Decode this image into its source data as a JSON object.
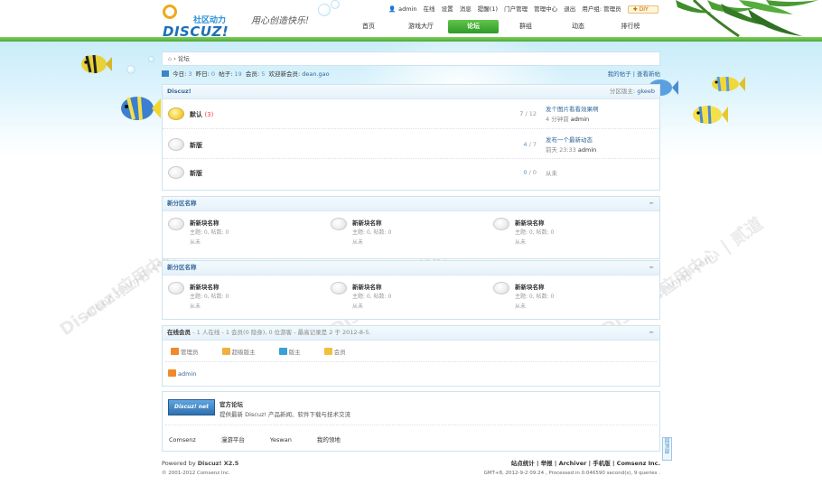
{
  "header": {
    "logo_cn": "社区动力",
    "logo_en": "DISCUZ!",
    "slogan": "用心创造快乐!",
    "user": {
      "name": "admin",
      "links": [
        "在线",
        "设置",
        "消息",
        "提醒(1)",
        "门户管理",
        "管理中心",
        "退出",
        "用户组: 管理员"
      ],
      "diy": "DIY"
    },
    "nav": [
      "首页",
      "游戏大厅",
      "论坛",
      "群组",
      "动态",
      "排行榜"
    ],
    "nav_active": 2
  },
  "breadcrumb": {
    "current": "论坛"
  },
  "stats": {
    "today_label": "今日:",
    "today": "3",
    "yesterday_label": "昨日:",
    "yesterday": "0",
    "posts_label": "帖子:",
    "posts": "19",
    "members_label": "会员:",
    "members": "5",
    "newmember_label": "欢迎新会员:",
    "newmember": "dean.gao",
    "link_mine": "我的帖子",
    "link_new": "查看新帖"
  },
  "sections": {
    "discuz": {
      "title": "Discuz!",
      "moderator_label": "分区版主:",
      "moderator": "gkeeb",
      "forums": [
        {
          "name": "默认",
          "today": "(3)",
          "threads": "7",
          "posts": "12",
          "last_title": "发个图片看看效果啊",
          "last_time": "4 分钟前",
          "last_user": "admin",
          "icon": "new"
        },
        {
          "name": "新版",
          "today": "",
          "threads": "4",
          "posts": "7",
          "last_title": "发布一个最新动态",
          "last_time": "前天 23:33",
          "last_user": "admin",
          "icon": "old"
        },
        {
          "name": "新版",
          "today": "",
          "threads": "0",
          "posts": "0",
          "last_title": "",
          "last_time": "从未",
          "last_user": "",
          "icon": "old"
        }
      ]
    },
    "new1": {
      "title": "新分区名称",
      "forums": [
        {
          "name": "新新块名称",
          "meta": "主题: 0, 帖数: 0",
          "last": "从未"
        },
        {
          "name": "新新块名称",
          "meta": "主题: 0, 帖数: 0",
          "last": "从未"
        },
        {
          "name": "新新块名称",
          "meta": "主题: 0, 帖数: 0",
          "last": "从未"
        }
      ]
    },
    "new2": {
      "title": "新分区名称",
      "forums": [
        {
          "name": "新新块名称",
          "meta": "主题: 0, 帖数: 0",
          "last": "从未"
        },
        {
          "name": "新新块名称",
          "meta": "主题: 0, 帖数: 0",
          "last": "从未"
        },
        {
          "name": "新新块名称",
          "meta": "主题: 0, 帖数: 0",
          "last": "从未"
        }
      ]
    }
  },
  "online": {
    "title": "在线会员",
    "summary": "- 1 人在线 - 1 会员(0 隐身), 0 位游客 - 最高记录是 2 于 2012-8-5.",
    "legend": [
      {
        "label": "管理员",
        "color": "#f08a2a"
      },
      {
        "label": "超级版主",
        "color": "#f0b040"
      },
      {
        "label": "版主",
        "color": "#3aa0d8"
      },
      {
        "label": "会员",
        "color": "#f0c040"
      }
    ],
    "users": [
      "admin"
    ]
  },
  "official": {
    "badge": "Discuz! net",
    "title": "官方论坛",
    "desc": "提供最新 Discuz! 产品新闻、软件下载与技术交流",
    "links": [
      "Comsenz",
      "漫游平台",
      "Yeswan",
      "我的领地"
    ]
  },
  "footer": {
    "powered": "Powered by",
    "brand": "Discuz! X2.5",
    "copyright": "© 2001-2012 Comsenz Inc.",
    "links": [
      "站点统计",
      "举报",
      "Archiver",
      "手机版",
      "Comsenz Inc."
    ],
    "timing": "GMT+8, 2012-9-2 09:24 , Processed in 0.046590 second(s), 9 queries ."
  },
  "backtop": "回顶部",
  "watermark": "Discuz!应用中心 | 贰道",
  "watermark_sub": "addon.dismall.com"
}
